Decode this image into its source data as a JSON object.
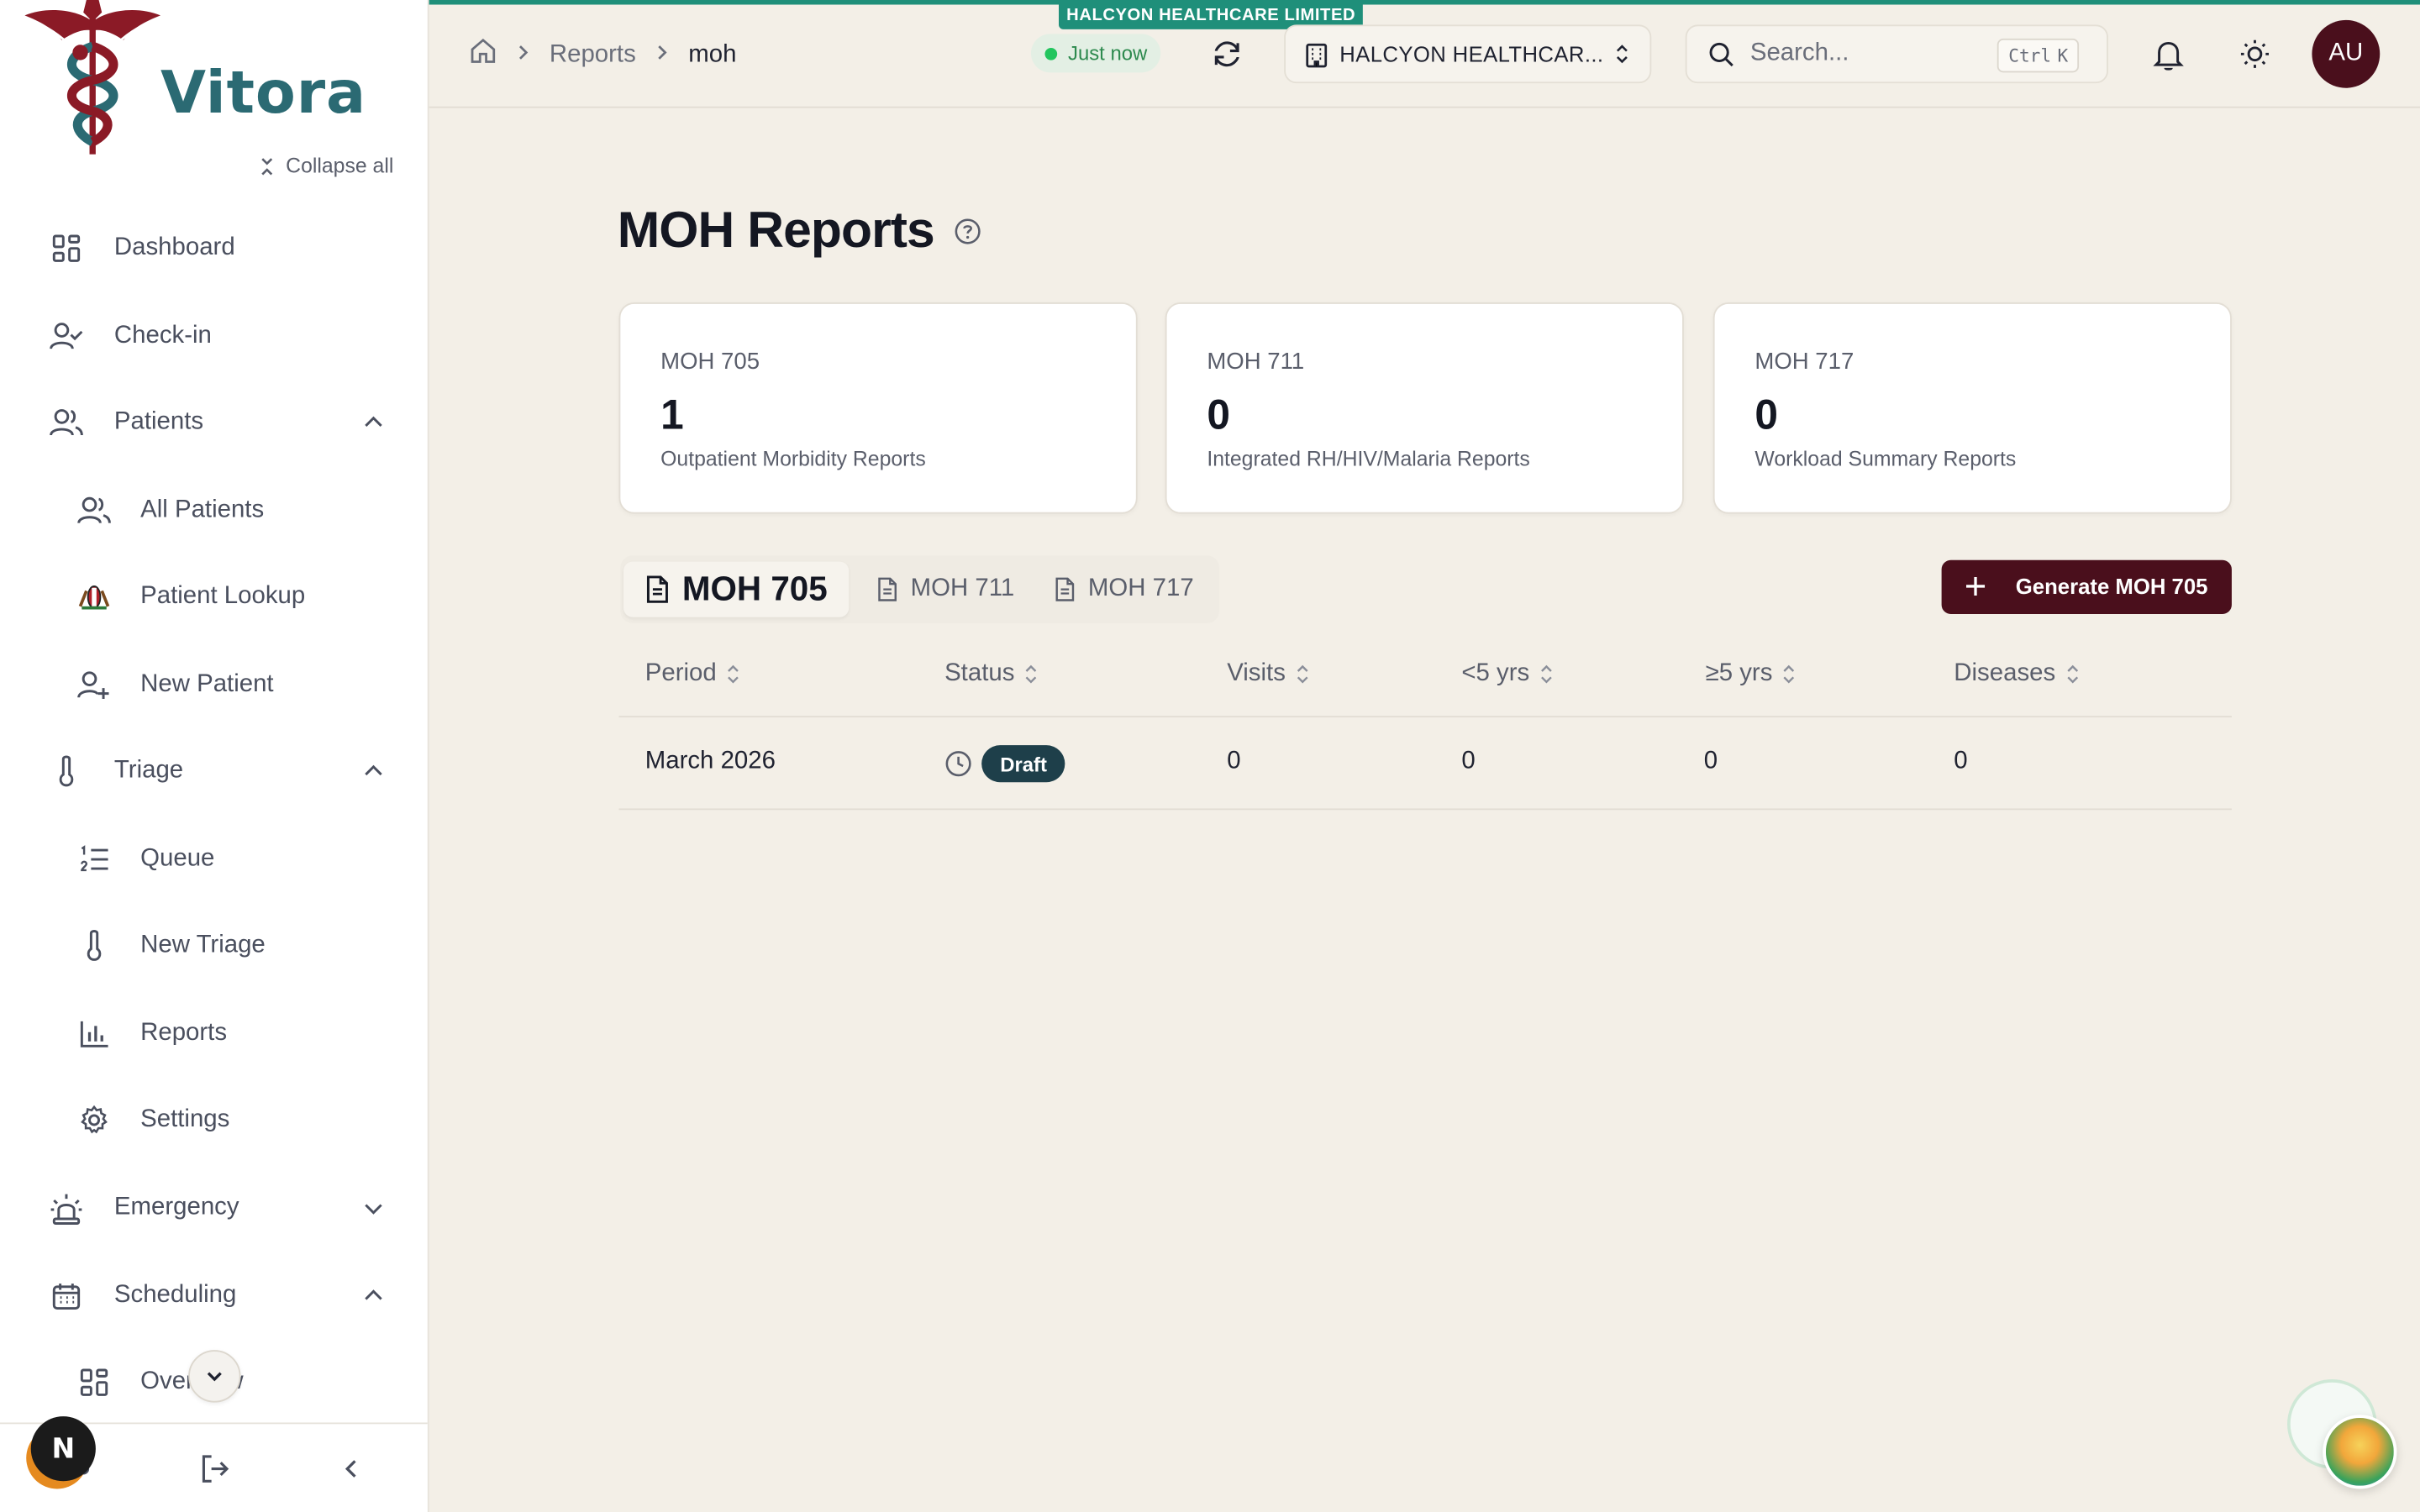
{
  "brand": {
    "name": "Vitora",
    "accent": "#4a0f1c",
    "logo_teal": "#2b6a73",
    "logo_red": "#8b1a26"
  },
  "sidebar": {
    "collapse_all": "Collapse all",
    "items": [
      {
        "label": "Dashboard",
        "icon": "dashboard-grid-icon",
        "level": "top"
      },
      {
        "label": "Check-in",
        "icon": "user-check-icon",
        "level": "top"
      },
      {
        "label": "Patients",
        "icon": "users-icon",
        "level": "top",
        "expanded": true
      },
      {
        "label": "All Patients",
        "icon": "users-icon",
        "level": "sub"
      },
      {
        "label": "Patient Lookup",
        "icon": "kenya-emblem-icon",
        "level": "sub"
      },
      {
        "label": "New Patient",
        "icon": "user-plus-icon",
        "level": "sub"
      },
      {
        "label": "Triage",
        "icon": "thermometer-icon",
        "level": "top",
        "expanded": true
      },
      {
        "label": "Queue",
        "icon": "list-ordered-icon",
        "level": "sub"
      },
      {
        "label": "New Triage",
        "icon": "thermometer-icon",
        "level": "sub"
      },
      {
        "label": "Reports",
        "icon": "bar-chart-icon",
        "level": "sub"
      },
      {
        "label": "Settings",
        "icon": "gear-icon",
        "level": "sub"
      },
      {
        "label": "Emergency",
        "icon": "siren-icon",
        "level": "top",
        "expanded": false
      },
      {
        "label": "Scheduling",
        "icon": "calendar-icon",
        "level": "top",
        "expanded": true
      },
      {
        "label": "Overview",
        "icon": "dashboard-grid-icon",
        "level": "sub"
      }
    ],
    "next_badge": "N"
  },
  "topbar": {
    "org_tag": "HALCYON HEALTHCARE LIMITED",
    "breadcrumb": [
      "Reports",
      "moh"
    ],
    "sync_status": "Just now",
    "org_selector": "HALCYON HEALTHCAR...",
    "search_placeholder": "Search...",
    "shortcut_ctrl": "Ctrl",
    "shortcut_key": "K",
    "avatar_initials": "AU"
  },
  "main": {
    "title": "MOH Reports",
    "cards": [
      {
        "code": "MOH 705",
        "count": "1",
        "desc": "Outpatient Morbidity Reports"
      },
      {
        "code": "MOH 711",
        "count": "0",
        "desc": "Integrated RH/HIV/Malaria Reports"
      },
      {
        "code": "MOH 717",
        "count": "0",
        "desc": "Workload Summary Reports"
      }
    ],
    "tabs": [
      "MOH 705",
      "MOH 711",
      "MOH 717"
    ],
    "generate_button": "Generate MOH 705",
    "table": {
      "columns": [
        "Period",
        "Status",
        "Visits",
        "<5 yrs",
        "≥5 yrs",
        "Diseases"
      ],
      "rows": [
        {
          "period": "March 2026",
          "status": "Draft",
          "visits": "0",
          "under5": "0",
          "over5": "0",
          "diseases": "0"
        }
      ]
    }
  }
}
